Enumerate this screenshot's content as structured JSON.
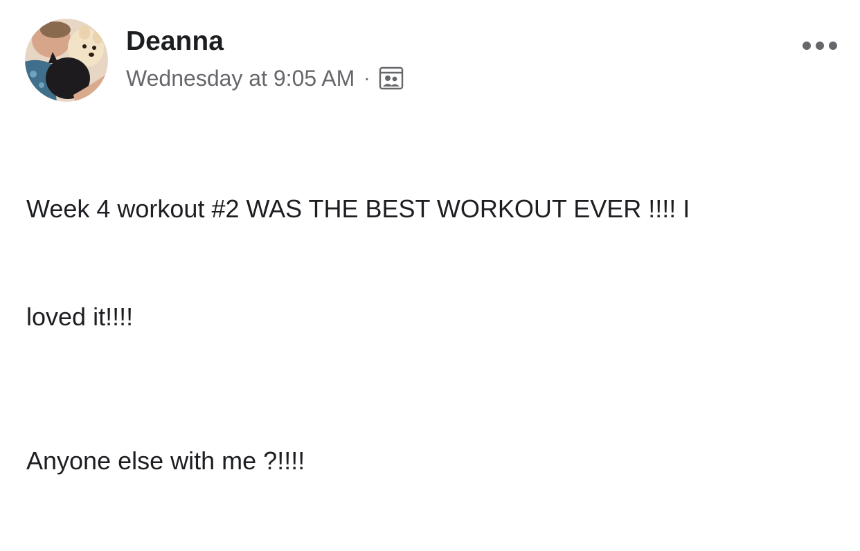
{
  "post": {
    "author": "Deanna",
    "timestamp": "Wednesday at 9:05 AM",
    "separator": "·",
    "privacy_icon": "group-privacy-icon",
    "more_icon": "more-options-icon",
    "body": {
      "line1": "Week 4 workout #2 WAS THE BEST WORKOUT EVER !!!! I",
      "line2": "loved it!!!!",
      "line3": "Anyone else with me ?!!!!"
    }
  },
  "colors": {
    "text_primary": "#1c1e21",
    "text_secondary": "#65676b",
    "background": "#ffffff"
  }
}
